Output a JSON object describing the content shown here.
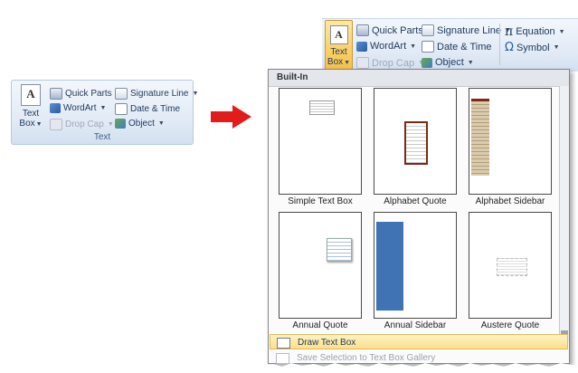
{
  "small_group": {
    "text_box_label_1": "Text",
    "text_box_label_2": "Box",
    "quick_parts": "Quick Parts",
    "signature_line": "Signature Line",
    "wordart": "WordArt",
    "date_time": "Date & Time",
    "drop_cap": "Drop Cap",
    "object": "Object",
    "group_label": "Text",
    "icon_letter": "A"
  },
  "big_ribbon": {
    "text_box_label_1": "Text",
    "text_box_label_2": "Box",
    "quick_parts": "Quick Parts",
    "signature_line": "Signature Line",
    "equation": "Equation",
    "wordart": "WordArt",
    "date_time": "Date & Time",
    "symbol": "Symbol",
    "drop_cap": "Drop Cap",
    "object": "Object",
    "equation_glyph": "π",
    "symbol_glyph": "Ω",
    "icon_letter": "A"
  },
  "gallery": {
    "header": "Built-In",
    "tiles": [
      {
        "caption": "Simple Text Box"
      },
      {
        "caption": "Alphabet Quote"
      },
      {
        "caption": "Alphabet Sidebar"
      },
      {
        "caption": "Annual Quote"
      },
      {
        "caption": "Annual Sidebar"
      },
      {
        "caption": "Austere Quote"
      }
    ],
    "draw_text_box": "Draw Text Box",
    "save_selection": "Save Selection to Text Box Gallery"
  },
  "colors": {
    "accent_active": "#fbd36b",
    "ribbon_bg": "#dfe9f5",
    "arrow_red": "#e21b1b",
    "annual_sidebar_blue": "#3f73b4",
    "alphabet_sidebar_tan": "#b9a27c"
  },
  "icons": [
    "text-box-icon",
    "quick-parts-icon",
    "signature-line-icon",
    "wordart-icon",
    "date-time-icon",
    "drop-cap-icon",
    "object-icon",
    "equation-icon",
    "symbol-icon",
    "draw-text-box-icon",
    "save-selection-icon"
  ]
}
